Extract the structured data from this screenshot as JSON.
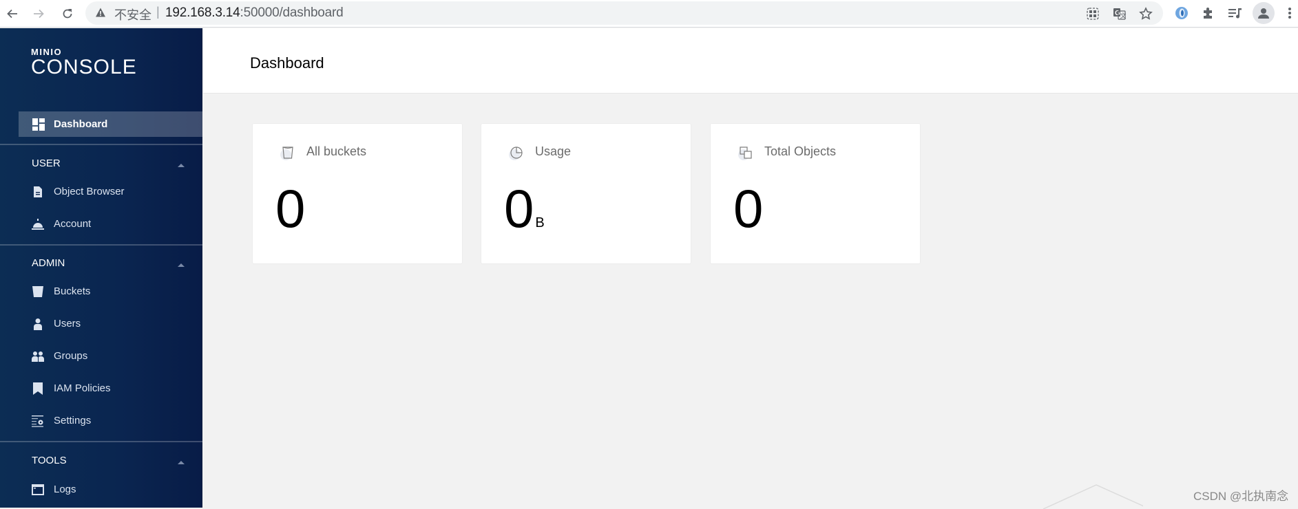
{
  "browser": {
    "security_label": "不安全",
    "url_host": "192.168.3.14",
    "url_path": ":50000/dashboard",
    "icons": [
      "back-icon",
      "forward-icon",
      "reload-icon",
      "warning-icon",
      "apps-grid-icon",
      "translate-icon",
      "bookmark-star-icon",
      "extension-orb-icon",
      "extensions-puzzle-icon",
      "media-playlist-icon",
      "profile-icon",
      "more-menu-icon"
    ]
  },
  "sidebar": {
    "logo_top": "MINIO",
    "logo_bottom": "CONSOLE",
    "active_item": {
      "label": "Dashboard",
      "icon": "dashboard-icon"
    },
    "sections": [
      {
        "title": "USER",
        "expanded": true,
        "items": [
          {
            "label": "Object Browser",
            "icon": "file-icon"
          },
          {
            "label": "Account",
            "icon": "bell-service-icon"
          }
        ]
      },
      {
        "title": "ADMIN",
        "expanded": true,
        "items": [
          {
            "label": "Buckets",
            "icon": "bucket-icon"
          },
          {
            "label": "Users",
            "icon": "user-icon"
          },
          {
            "label": "Groups",
            "icon": "groups-icon"
          },
          {
            "label": "IAM Policies",
            "icon": "bookmark-icon"
          },
          {
            "label": "Settings",
            "icon": "settings-icon"
          }
        ]
      },
      {
        "title": "TOOLS",
        "expanded": true,
        "items": [
          {
            "label": "Logs",
            "icon": "terminal-window-icon"
          }
        ]
      }
    ]
  },
  "main": {
    "title": "Dashboard",
    "cards": [
      {
        "title": "All buckets",
        "value": "0",
        "unit": "",
        "icon": "bucket-icon"
      },
      {
        "title": "Usage",
        "value": "0",
        "unit": "B",
        "icon": "pie-chart-icon"
      },
      {
        "title": "Total Objects",
        "value": "0",
        "unit": "",
        "icon": "objects-icon"
      }
    ]
  },
  "watermark": "CSDN @北执南念",
  "colors": {
    "sidebar_bg": "#0a2550",
    "content_bg": "#f2f2f2",
    "card_bg": "#ffffff"
  }
}
